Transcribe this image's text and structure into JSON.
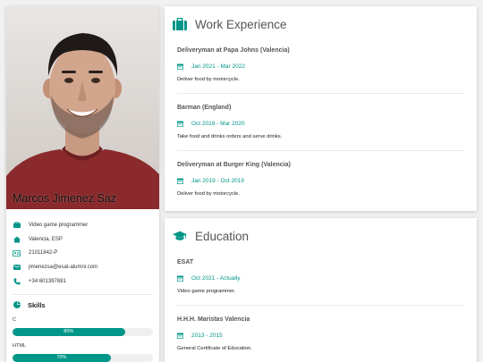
{
  "profile": {
    "name": "Marcos Jimenez Saz",
    "info": [
      {
        "icon": "briefcase-icon",
        "text": "Video game programmer"
      },
      {
        "icon": "home-icon",
        "text": "Valencia, ESP"
      },
      {
        "icon": "id-card-icon",
        "text": "21011842-P"
      },
      {
        "icon": "envelope-icon",
        "text": "jimenezsa@esat-alumni.com"
      },
      {
        "icon": "phone-icon",
        "text": "+34 601397881"
      }
    ],
    "skills_title": "Skills",
    "skills": [
      {
        "name": "C",
        "percent_label": "80%",
        "level": 80
      },
      {
        "name": "HTML",
        "percent_label": "70%",
        "level": 70
      }
    ]
  },
  "work": {
    "title": "Work Experience",
    "entries": [
      {
        "role": "Deliveryman at Papa Johns (Valencia)",
        "date": "Jan 2021 - Mar 2022",
        "desc": "Deliver food by motorcycle."
      },
      {
        "role": "Barman (England)",
        "date": "Oct 2019 - Mar 2020",
        "desc": "Take food and drinks orders and serve drinks."
      },
      {
        "role": "Deliveryman at Burger King (Valencia)",
        "date": "Jan 2019 - Oct 2019",
        "desc": "Deliver food by motorcycle."
      }
    ]
  },
  "education": {
    "title": "Education",
    "entries": [
      {
        "role": "ESAT",
        "date": "Oct 2021 - Actually",
        "desc": "Video game programmer."
      },
      {
        "role": "H.H.H. Maristas Valencia",
        "date": "2013 - 2015",
        "desc": "General Certificate of Education."
      }
    ]
  },
  "colors": {
    "accent": "#009688",
    "background": "#f1f1f1"
  }
}
